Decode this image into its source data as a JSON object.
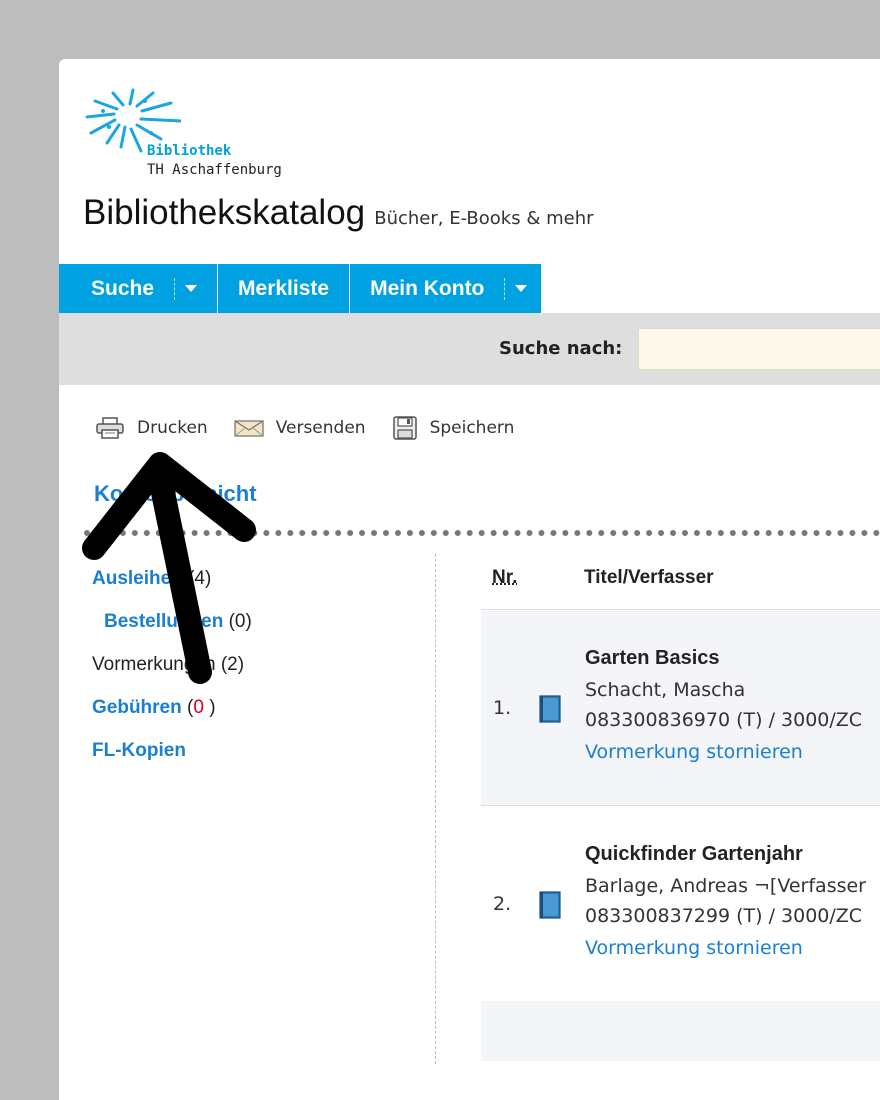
{
  "logo": {
    "line1": "Bibliothek",
    "line2": "TH Aschaffenburg"
  },
  "header": {
    "title": "Bibliothekskatalog",
    "subtitle": "Bücher, E-Books & mehr"
  },
  "nav": {
    "items": [
      {
        "label": "Suche"
      },
      {
        "label": "Merkliste"
      },
      {
        "label": "Mein Konto"
      }
    ]
  },
  "search": {
    "label": "Suche nach:",
    "value": ""
  },
  "tools": {
    "print": "Drucken",
    "send": "Versenden",
    "save": "Speichern"
  },
  "account": {
    "heading": "Kontoübersicht"
  },
  "sidebar": {
    "items": [
      {
        "label": "Ausleihen",
        "count": "(4)"
      },
      {
        "label": "Bestellungen",
        "count": "(0)"
      },
      {
        "label": "Vormerkungen",
        "count": "(2)"
      },
      {
        "label": "Gebühren",
        "open": " (",
        "count": "0",
        "close": " )"
      },
      {
        "label": "FL-Kopien"
      }
    ]
  },
  "table": {
    "headers": {
      "nr": "Nr.",
      "title": "Titel/Verfasser"
    },
    "rows": [
      {
        "nr": "1.",
        "title": "Garten Basics",
        "author": "Schacht, Mascha",
        "signature": "083300836970 (T) / 3000/ZC",
        "action": "Vormerkung stornieren"
      },
      {
        "nr": "2.",
        "title": "Quickfinder Gartenjahr",
        "author": "Barlage, Andreas ¬[Verfasser",
        "signature": "083300837299 (T) / 3000/ZC",
        "action": "Vormerkung stornieren"
      }
    ]
  },
  "colors": {
    "accent": "#00a1e0",
    "link": "#1a7fd4",
    "fee": "#d9001b",
    "searchBar": "#dedede"
  },
  "icons": [
    "printer-icon",
    "envelope-icon",
    "floppy-disk-icon",
    "book-icon",
    "chevron-down-icon",
    "arrow-annotation"
  ]
}
